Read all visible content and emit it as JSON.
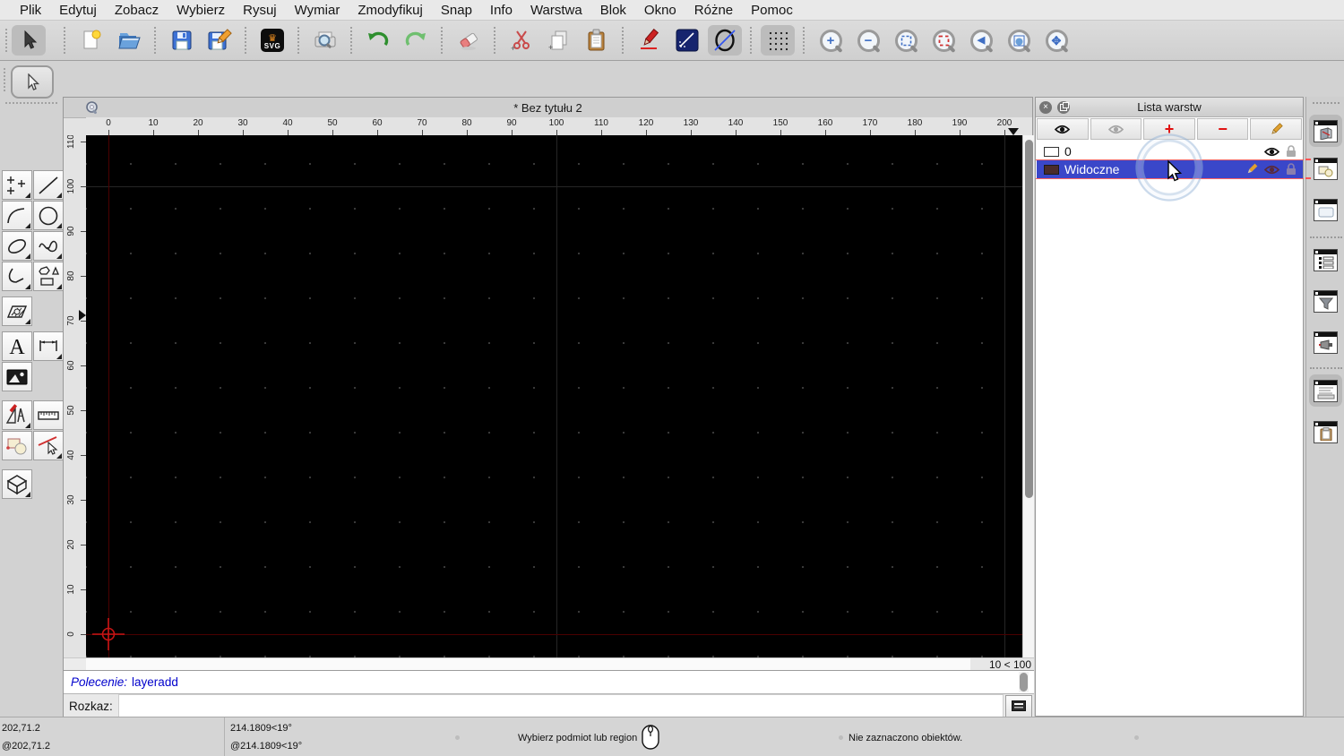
{
  "colors": {
    "sel-blue": "#3a47c9",
    "flash-red": "#ff4646",
    "canvas-black": "#000000",
    "axis-red": "#cc1414",
    "accent-blue-tool": "#3f6fc4"
  },
  "menu_bar": {
    "items": [
      "Plik",
      "Edytuj",
      "Zobacz",
      "Wybierz",
      "Rysuj",
      "Wymiar",
      "Zmodyfikuj",
      "Snap",
      "Info",
      "Warstwa",
      "Blok",
      "Okno",
      "Różne",
      "Pomoc"
    ]
  },
  "toolbar": {
    "svg_label": "SVG",
    "crown_glyph": "♛",
    "zoom_in_glyph": "+",
    "zoom_out_glyph": "−",
    "zoom_back_glyph": "◀",
    "zoom_pan_glyph": "✥"
  },
  "document_window": {
    "title": "* Bez tytułu 2",
    "grid_status": "10 < 100",
    "h_ruler_labels": [
      "0",
      "10",
      "20",
      "30",
      "40",
      "50",
      "60",
      "70",
      "80",
      "90",
      "100",
      "110",
      "120",
      "130",
      "140",
      "150",
      "160",
      "170",
      "180",
      "190",
      "200"
    ],
    "v_ruler_labels": [
      "110",
      "100",
      "90",
      "80",
      "70",
      "60",
      "50",
      "40",
      "30",
      "20",
      "10",
      "0"
    ]
  },
  "command_area": {
    "history_label": "Polecenie:",
    "history_value": "layeradd",
    "prompt_label": "Rozkaz:",
    "input_value": ""
  },
  "layers_panel": {
    "title": "Lista warstw",
    "icons": {
      "close": "×",
      "add": "+",
      "remove": "−"
    },
    "layers": [
      {
        "name": "0",
        "color": "#ffffff",
        "selected": false
      },
      {
        "name": "Widoczne",
        "color": "#4a2b2b",
        "selected": true
      }
    ]
  },
  "status_bar": {
    "abs_coord": "202,71.2",
    "rel_coord": "@202,71.2",
    "abs_polar": "214.1809<19°",
    "rel_polar": "@214.1809<19°",
    "hint": "Wybierz podmiot lub region",
    "selection_info": "Nie zaznaczono obiektów."
  }
}
